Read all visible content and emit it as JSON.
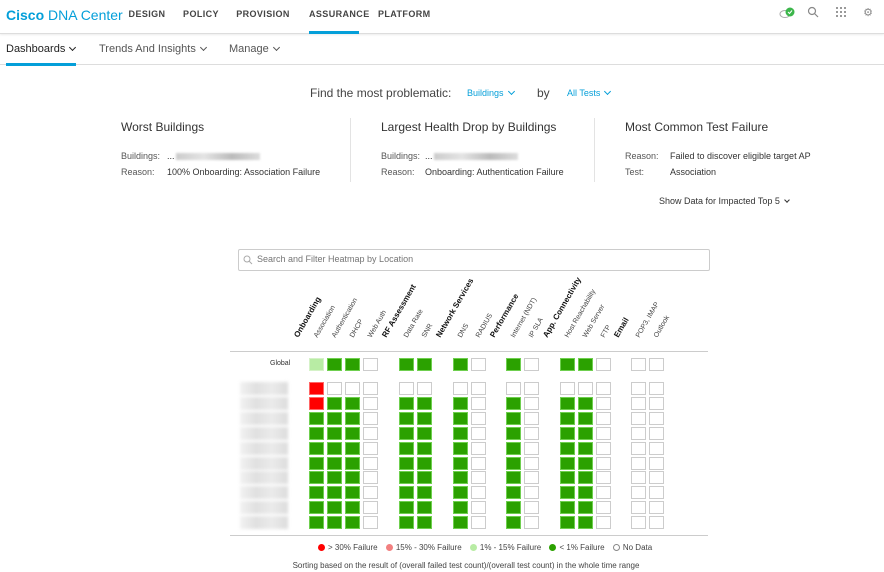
{
  "app": {
    "brand_bold": "Cisco",
    "brand_rest": " DNA Center"
  },
  "nav": [
    {
      "label": "DESIGN"
    },
    {
      "label": "POLICY"
    },
    {
      "label": "PROVISION"
    },
    {
      "label": "ASSURANCE",
      "active": true
    },
    {
      "label": "PLATFORM"
    }
  ],
  "top_icons": [
    "cloud-status-icon",
    "search-icon",
    "apps-grid-icon",
    "gear-icon"
  ],
  "subnav": [
    {
      "label": "Dashboards",
      "active": true
    },
    {
      "label": "Trends And Insights"
    },
    {
      "label": "Manage"
    }
  ],
  "finder": {
    "prefix": "Find the most problematic:",
    "type": "Buildings",
    "by": "by",
    "tests": "All Tests"
  },
  "cards": [
    {
      "title": "Worst Buildings",
      "row1_label": "Buildings:",
      "row1_value": "...",
      "row2_label": "Reason:",
      "row2_value": "100% Onboarding: Association Failure"
    },
    {
      "title": "Largest Health Drop by Buildings",
      "row1_label": "Buildings:",
      "row1_value": "...",
      "row2_label": "Reason:",
      "row2_value": "Onboarding: Authentication Failure"
    },
    {
      "title": "Most Common Test Failure",
      "row1_label": "Reason:",
      "row1_value": "Failed to discover eligible target AP",
      "row2_label": "Test:",
      "row2_value": "Association"
    }
  ],
  "show_top5": "Show Data for Impacted Top 5",
  "search": {
    "placeholder": "Search and Filter Heatmap by Location"
  },
  "heatmap": {
    "groups": [
      {
        "name": "Onboarding",
        "tests": [
          "Association",
          "Authentication",
          "DHCP",
          "Web Auth"
        ]
      },
      {
        "name": "RF Assessment",
        "tests": [
          "Data Rate",
          "SNR"
        ]
      },
      {
        "name": "Network Services",
        "tests": [
          "DNS",
          "RADIUS"
        ]
      },
      {
        "name": "Performance",
        "tests": [
          "Internet (NDT)",
          "IP SLA"
        ]
      },
      {
        "name": "App. Connectivity",
        "tests": [
          "Host Reachability",
          "Web Server",
          "FTP"
        ]
      },
      {
        "name": "Email",
        "tests": [
          "POP3, IMAP",
          "Outlook"
        ]
      }
    ],
    "global_label": "Global",
    "global": [
      "lg",
      "g",
      "g",
      "n",
      "g",
      "g",
      "g",
      "n",
      "g",
      "n",
      "g",
      "g",
      "n",
      "n",
      "n"
    ],
    "rows": [
      [
        "r",
        "n",
        "n",
        "n",
        "n",
        "n",
        "n",
        "n",
        "n",
        "n",
        "n",
        "n",
        "n",
        "n",
        "n"
      ],
      [
        "r",
        "g",
        "g",
        "n",
        "g",
        "g",
        "g",
        "n",
        "g",
        "n",
        "g",
        "g",
        "n",
        "n",
        "n"
      ],
      [
        "g",
        "g",
        "g",
        "n",
        "g",
        "g",
        "g",
        "n",
        "g",
        "n",
        "g",
        "g",
        "n",
        "n",
        "n"
      ],
      [
        "g",
        "g",
        "g",
        "n",
        "g",
        "g",
        "g",
        "n",
        "g",
        "n",
        "g",
        "g",
        "n",
        "n",
        "n"
      ],
      [
        "g",
        "g",
        "g",
        "n",
        "g",
        "g",
        "g",
        "n",
        "g",
        "n",
        "g",
        "g",
        "n",
        "n",
        "n"
      ],
      [
        "g",
        "g",
        "g",
        "n",
        "g",
        "g",
        "g",
        "n",
        "g",
        "n",
        "g",
        "g",
        "n",
        "n",
        "n"
      ],
      [
        "g",
        "g",
        "g",
        "n",
        "g",
        "g",
        "g",
        "n",
        "g",
        "n",
        "g",
        "g",
        "n",
        "n",
        "n"
      ],
      [
        "g",
        "g",
        "g",
        "n",
        "g",
        "g",
        "g",
        "n",
        "g",
        "n",
        "g",
        "g",
        "n",
        "n",
        "n"
      ],
      [
        "g",
        "g",
        "g",
        "n",
        "g",
        "g",
        "g",
        "n",
        "g",
        "n",
        "g",
        "g",
        "n",
        "n",
        "n"
      ],
      [
        "g",
        "g",
        "g",
        "n",
        "g",
        "g",
        "g",
        "n",
        "g",
        "n",
        "g",
        "g",
        "n",
        "n",
        "n"
      ]
    ]
  },
  "legend": [
    {
      "label": "> 30% Failure",
      "color": "#ff0000"
    },
    {
      "label": "15% - 30% Failure",
      "color": "#f28080"
    },
    {
      "label": "1% - 15% Failure",
      "color": "#b8eca4"
    },
    {
      "label": "< 1% Failure",
      "color": "#2ba100"
    },
    {
      "label": "No Data",
      "color": "none"
    }
  ],
  "note": "Sorting based on the result of (overall failed test count)/(overall test count) in the whole time range"
}
